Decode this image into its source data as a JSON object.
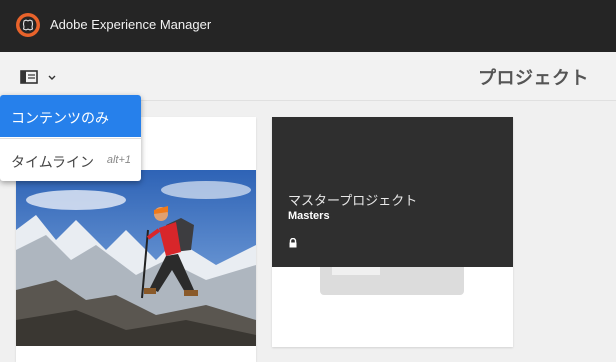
{
  "app": {
    "title": "Adobe Experience Manager"
  },
  "toolbar": {
    "page_title": "プロジェクト"
  },
  "view_menu": {
    "items": [
      {
        "label": "コンテンツのみ",
        "shortcut": "",
        "selected": true
      },
      {
        "label": "タイムライン",
        "shortcut": "alt+1",
        "selected": false
      }
    ]
  },
  "cards": [
    {
      "type": "project",
      "image": "hiker-in-mountains"
    },
    {
      "title_jp": "マスタープロジェクト",
      "title_en": "Masters",
      "icon": "lock-icon"
    }
  ],
  "colors": {
    "topbar": "#252525",
    "accent": "#2680eb",
    "logo": "#e8632b"
  }
}
